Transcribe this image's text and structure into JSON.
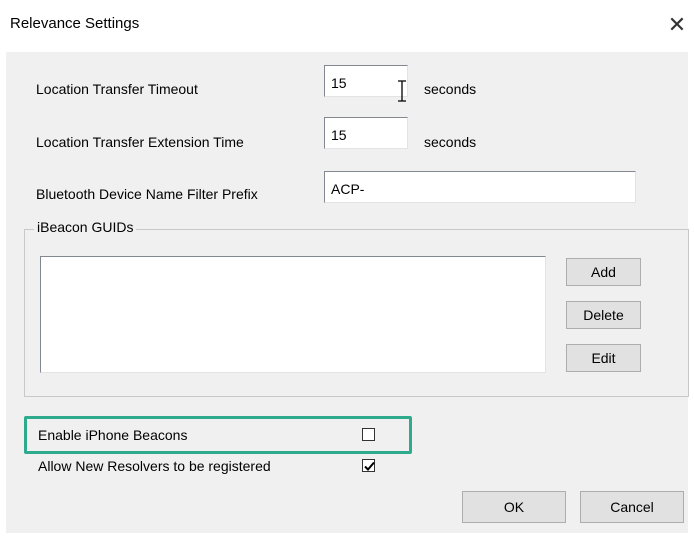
{
  "window": {
    "title": "Relevance Settings",
    "close_glyph": "✕"
  },
  "fields": {
    "location_transfer_timeout": {
      "label": "Location Transfer Timeout",
      "value": "15",
      "unit": "seconds"
    },
    "location_transfer_extension": {
      "label": "Location Transfer Extension Time",
      "value": "15",
      "unit": "seconds"
    },
    "bluetooth_prefix": {
      "label": "Bluetooth Device Name Filter Prefix",
      "value": "ACP-"
    }
  },
  "ibeacon_group": {
    "title": "iBeacon GUIDs",
    "items": [],
    "buttons": {
      "add": "Add",
      "delete": "Delete",
      "edit": "Edit"
    }
  },
  "options": {
    "enable_iphone_beacons": {
      "label": "Enable iPhone Beacons",
      "checked": false
    },
    "allow_new_resolvers": {
      "label": "Allow New Resolvers to be registered",
      "checked": true
    }
  },
  "footer": {
    "ok": "OK",
    "cancel": "Cancel"
  },
  "colors": {
    "highlight": "#2eab8c",
    "dialog_bg": "#f0f0f0"
  }
}
